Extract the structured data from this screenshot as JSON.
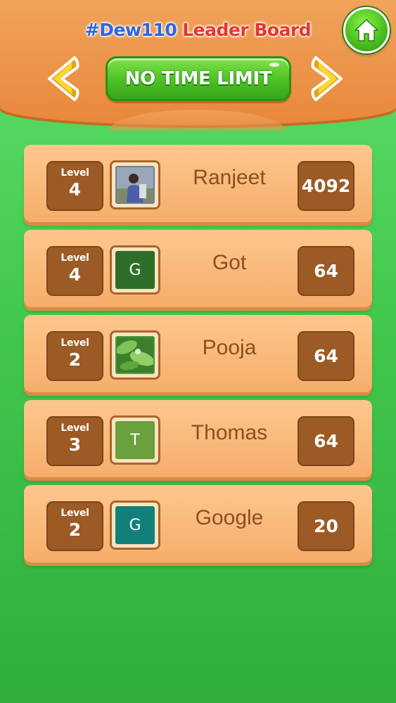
{
  "header": {
    "title_handle": "#Dew110",
    "title_board": "Leader Board",
    "mode_label": "NO TIME LIMIT",
    "prev_icon": "chevron-left-icon",
    "next_icon": "chevron-right-icon",
    "home_icon": "home-icon"
  },
  "colors": {
    "header_orange": "#e8873c",
    "background_green": "#42c84c",
    "row_orange": "#f6ad6b",
    "box_brown": "#9c5a24",
    "name_brown": "#8c4e1e",
    "handle_blue": "#2f66e0",
    "board_red": "#e8352a"
  },
  "leaderboard": {
    "level_label": "Level",
    "entries": [
      {
        "level": "4",
        "name": "Ranjeet",
        "score": "4092",
        "avatar_type": "photo-person",
        "avatar_letter": "",
        "avatar_color": "#6f7f9a"
      },
      {
        "level": "4",
        "name": "Got",
        "score": "64",
        "avatar_type": "letter",
        "avatar_letter": "G",
        "avatar_color": "#2f6e2a"
      },
      {
        "level": "2",
        "name": "Pooja",
        "score": "64",
        "avatar_type": "photo-leaves",
        "avatar_letter": "",
        "avatar_color": "#4f9a3a"
      },
      {
        "level": "3",
        "name": "Thomas",
        "score": "64",
        "avatar_type": "letter",
        "avatar_letter": "T",
        "avatar_color": "#6a9f3e"
      },
      {
        "level": "2",
        "name": "Google",
        "score": "20",
        "avatar_type": "letter",
        "avatar_letter": "G",
        "avatar_color": "#12807a"
      }
    ]
  }
}
